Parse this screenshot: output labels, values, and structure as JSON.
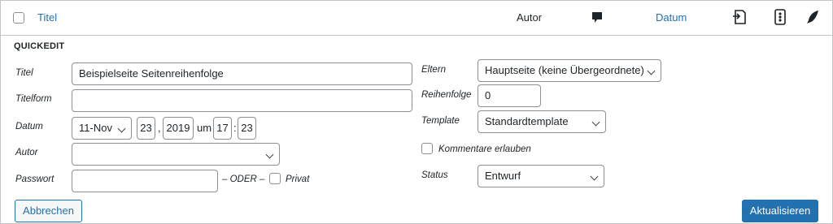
{
  "header": {
    "title": "Titel",
    "author": "Autor",
    "date": "Datum"
  },
  "quickedit": {
    "heading": "QUICKEDIT",
    "title_label": "Titel",
    "title_value": "Beispielseite Seitenreihenfolge",
    "slug_label": "Titelform",
    "slug_value": "",
    "date_label": "Datum",
    "month_value": "11-Nov",
    "day_value": "23",
    "year_value": "2019",
    "at_text": "um",
    "hour_value": "17",
    "minute_value": "23",
    "comma": ",",
    "colon": ":",
    "author_label": "Autor",
    "author_value": "",
    "password_label": "Passwort",
    "password_value": "",
    "or_text": "– ODER –",
    "private_label": "Privat",
    "parent_label": "Eltern",
    "parent_value": "Hauptseite (keine Übergeordnete)",
    "order_label": "Reihenfolge",
    "order_value": "0",
    "template_label": "Template",
    "template_value": "Standardtemplate",
    "comments_label": "Kommentare erlauben",
    "status_label": "Status",
    "status_value": "Entwurf",
    "cancel_button": "Abbrechen",
    "update_button": "Aktualisieren"
  },
  "colors": {
    "accent": "#2271b1",
    "border": "#c3c4c7",
    "text": "#1d2327"
  }
}
